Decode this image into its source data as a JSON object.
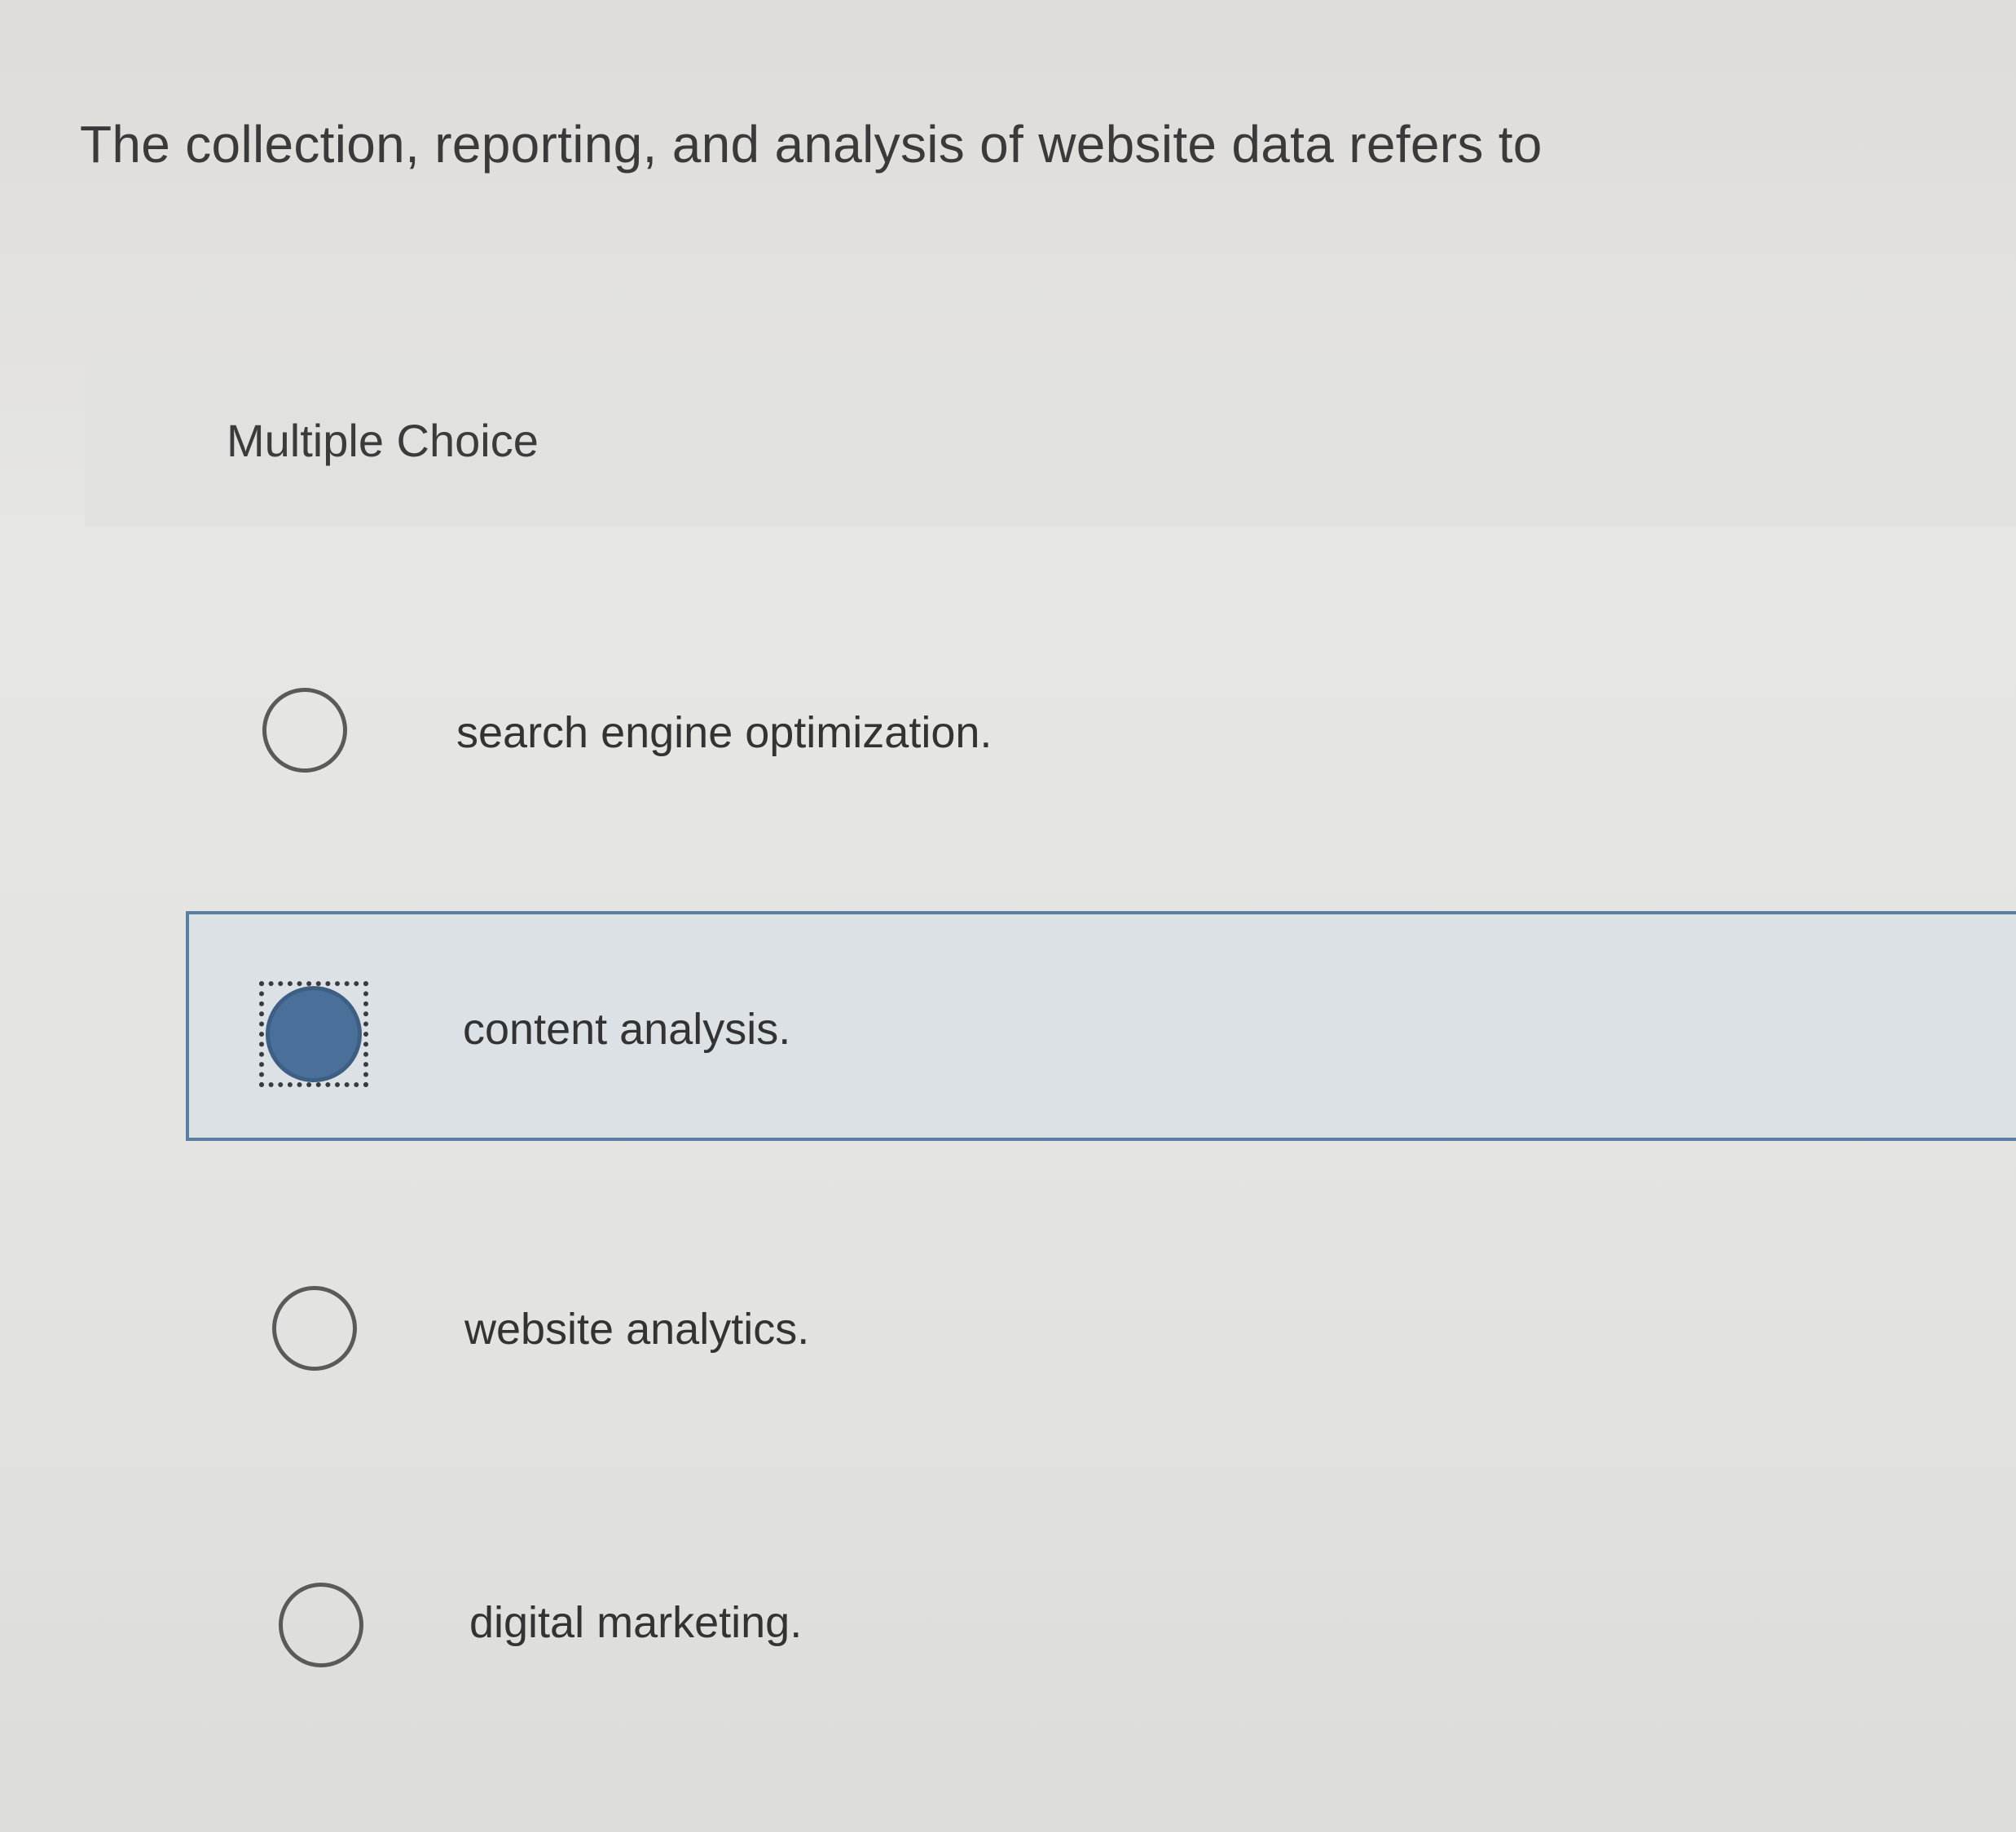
{
  "question": {
    "text": "The collection, reporting, and analysis of website data refers to"
  },
  "section": {
    "label": "Multiple Choice"
  },
  "options": [
    {
      "label": "search engine optimization.",
      "selected": false
    },
    {
      "label": "content analysis.",
      "selected": true
    },
    {
      "label": "website analytics.",
      "selected": false
    },
    {
      "label": "digital marketing.",
      "selected": false
    }
  ],
  "colors": {
    "selected_fill": "#4a6f98",
    "selected_border": "#5b7ea3",
    "selected_background": "#dbe1e5"
  }
}
